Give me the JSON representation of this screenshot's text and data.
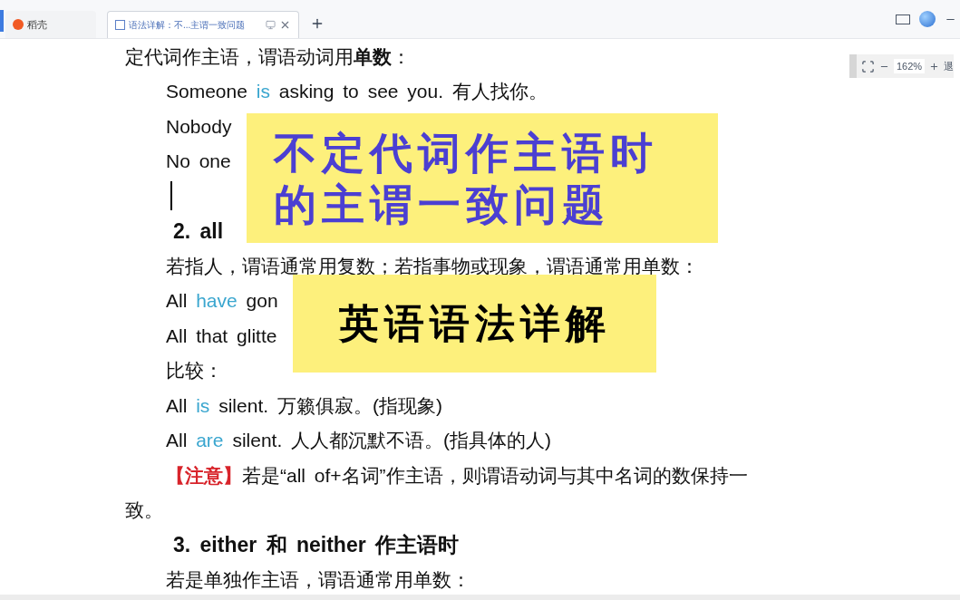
{
  "tabs": [
    {
      "label": "稻壳",
      "kind": "home",
      "selected": false
    },
    {
      "label": "语法详解：不...主谓一致问题",
      "kind": "document",
      "selected": true
    }
  ],
  "zoom_bar": {
    "zoom": "162%",
    "exit": "退"
  },
  "document": {
    "lines": [
      {
        "kind": "para",
        "parts": [
          {
            "text": "定代词作主语，谓语动词用",
            "kind": "plain"
          },
          {
            "text": "单数",
            "kind": "bold"
          },
          {
            "text": "：",
            "kind": "plain"
          }
        ]
      },
      {
        "kind": "example",
        "parts": [
          {
            "text": "Someone ",
            "kind": "plain"
          },
          {
            "text": "is",
            "kind": "verb"
          },
          {
            "text": " asking to see you. 有人找你。",
            "kind": "plain"
          }
        ]
      },
      {
        "kind": "example",
        "parts": [
          {
            "text": "Nobody",
            "kind": "plain"
          }
        ]
      },
      {
        "kind": "example",
        "parts": [
          {
            "text": "No one",
            "kind": "plain"
          }
        ]
      },
      {
        "kind": "cursor"
      },
      {
        "kind": "heading",
        "parts": [
          {
            "text": "2. all",
            "kind": "bold"
          }
        ]
      },
      {
        "kind": "example",
        "parts": [
          {
            "text": "若指人，谓语通常用复数；若指事物或现象，谓语通常用单数：",
            "kind": "plain"
          }
        ]
      },
      {
        "kind": "example",
        "parts": [
          {
            "text": "All ",
            "kind": "plain"
          },
          {
            "text": "have",
            "kind": "verb"
          },
          {
            "text": " gon",
            "kind": "plain"
          }
        ]
      },
      {
        "kind": "example",
        "parts": [
          {
            "text": "All that glitte",
            "kind": "plain"
          }
        ]
      },
      {
        "kind": "example",
        "parts": [
          {
            "text": "比较：",
            "kind": "plain"
          }
        ]
      },
      {
        "kind": "example",
        "parts": [
          {
            "text": "All ",
            "kind": "plain"
          },
          {
            "text": "is",
            "kind": "verb"
          },
          {
            "text": " silent. 万籁俱寂。(指现象)",
            "kind": "plain"
          }
        ]
      },
      {
        "kind": "example",
        "parts": [
          {
            "text": "All ",
            "kind": "plain"
          },
          {
            "text": "are",
            "kind": "verb"
          },
          {
            "text": " silent. 人人都沉默不语。(指具体的人)",
            "kind": "plain"
          }
        ]
      },
      {
        "kind": "example",
        "parts": [
          {
            "text": "【注意】",
            "kind": "alert"
          },
          {
            "text": "若是“all of+名词”作主语，则谓语动词与其中名词的数保持一",
            "kind": "plain"
          }
        ]
      },
      {
        "kind": "para",
        "parts": [
          {
            "text": "致。",
            "kind": "plain"
          }
        ]
      },
      {
        "kind": "heading",
        "parts": [
          {
            "text": "3. either 和 neither 作主语时",
            "kind": "bold"
          }
        ]
      },
      {
        "kind": "example",
        "parts": [
          {
            "text": "若是单独作主语，谓语通常用单数：",
            "kind": "plain"
          }
        ]
      }
    ]
  },
  "banners": [
    {
      "kind": "title",
      "lines": [
        "不定代词作主语时",
        "的主谓一致问题"
      ]
    },
    {
      "kind": "subtitle",
      "lines": [
        "英语语法详解"
      ]
    }
  ]
}
